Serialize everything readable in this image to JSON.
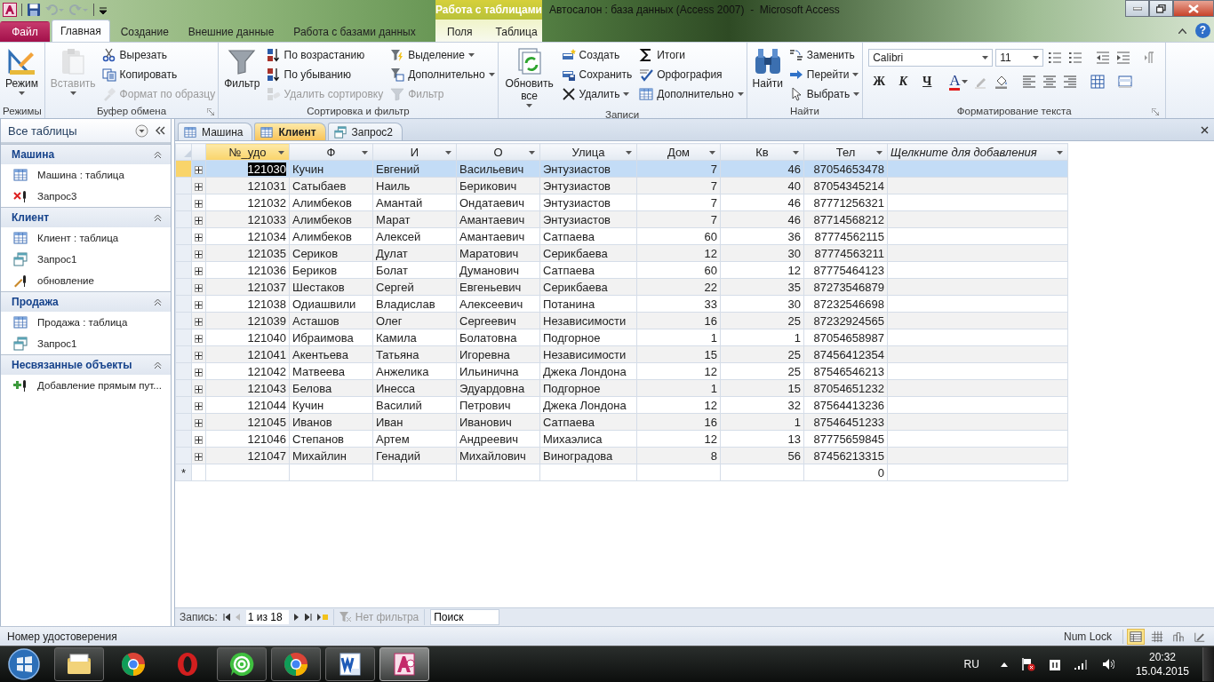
{
  "title_bar": {
    "context_group": "Работа с таблицами",
    "title": "Автосалон : база данных (Access 2007)  -  Microsoft Access",
    "help": "?"
  },
  "ribbon_tabs": [
    {
      "label": "Файл",
      "kind": "file",
      "selected": false
    },
    {
      "label": "Главная",
      "kind": "normal",
      "selected": true
    },
    {
      "label": "Создание",
      "kind": "normal",
      "selected": false
    },
    {
      "label": "Внешние данные",
      "kind": "normal",
      "selected": false
    },
    {
      "label": "Работа с базами данных",
      "kind": "normal",
      "selected": false
    },
    {
      "label": "Поля",
      "kind": "context",
      "selected": false
    },
    {
      "label": "Таблица",
      "kind": "context",
      "selected": false
    }
  ],
  "ribbon_groups": [
    {
      "label": "Режимы",
      "launcher": false,
      "items": [
        {
          "label": "Режим",
          "kind": "large",
          "dropdown": true,
          "disabled": false
        }
      ]
    },
    {
      "label": "Буфер обмена",
      "launcher": true,
      "items": [
        {
          "label": "Вставить",
          "kind": "large",
          "dropdown": true,
          "disabled": true
        },
        {
          "label": "Вырезать",
          "kind": "small",
          "dropdown": false,
          "disabled": false
        },
        {
          "label": "Копировать",
          "kind": "small",
          "dropdown": false,
          "disabled": false
        },
        {
          "label": "Формат по образцу",
          "kind": "small",
          "dropdown": false,
          "disabled": true
        }
      ]
    },
    {
      "label": "Сортировка и фильтр",
      "launcher": false,
      "items": [
        {
          "label": "Фильтр",
          "kind": "large",
          "dropdown": false,
          "disabled": false
        },
        {
          "label": "По возрастанию",
          "kind": "small",
          "dropdown": false,
          "disabled": false
        },
        {
          "label": "По убыванию",
          "kind": "small",
          "dropdown": false,
          "disabled": false
        },
        {
          "label": "Удалить сортировку",
          "kind": "small",
          "dropdown": false,
          "disabled": true
        },
        {
          "label": "Выделение",
          "kind": "small",
          "dropdown": true,
          "disabled": false
        },
        {
          "label": "Дополнительно",
          "kind": "small",
          "dropdown": true,
          "disabled": false
        },
        {
          "label": "Фильтр",
          "kind": "small",
          "dropdown": false,
          "disabled": true
        }
      ]
    },
    {
      "label": "Записи",
      "launcher": false,
      "items": [
        {
          "label": "Обновить все",
          "kind": "large",
          "dropdown": true,
          "disabled": false
        },
        {
          "label": "Создать",
          "kind": "small",
          "dropdown": false,
          "disabled": false
        },
        {
          "label": "Сохранить",
          "kind": "small",
          "dropdown": false,
          "disabled": false
        },
        {
          "label": "Удалить",
          "kind": "small",
          "dropdown": true,
          "disabled": false
        },
        {
          "label": "Итоги",
          "kind": "small",
          "dropdown": false,
          "disabled": false
        },
        {
          "label": "Орфография",
          "kind": "small",
          "dropdown": false,
          "disabled": false
        },
        {
          "label": "Дополнительно",
          "kind": "small",
          "dropdown": true,
          "disabled": false
        }
      ]
    },
    {
      "label": "Найти",
      "launcher": false,
      "items": [
        {
          "label": "Найти",
          "kind": "large",
          "dropdown": false,
          "disabled": false
        },
        {
          "label": "Заменить",
          "kind": "small",
          "dropdown": false,
          "disabled": false
        },
        {
          "label": "Перейти",
          "kind": "small",
          "dropdown": true,
          "disabled": false
        },
        {
          "label": "Выбрать",
          "kind": "small",
          "dropdown": true,
          "disabled": false
        }
      ]
    }
  ],
  "text_format_group": {
    "label": "Форматирование текста",
    "launcher": true,
    "font": "Calibri",
    "size": "11",
    "style_buttons": [
      "Ж",
      "К",
      "Ч"
    ],
    "font_color": "A"
  },
  "nav_pane": {
    "title": "Все таблицы",
    "groups": [
      {
        "title": "Машина",
        "items": [
          {
            "label": "Машина : таблица",
            "kind": "table"
          },
          {
            "label": "Запрос3",
            "kind": "delete_query"
          }
        ]
      },
      {
        "title": "Клиент",
        "items": [
          {
            "label": "Клиент : таблица",
            "kind": "table"
          },
          {
            "label": "Запрос1",
            "kind": "select_query"
          },
          {
            "label": "обновление",
            "kind": "update_query"
          }
        ]
      },
      {
        "title": "Продажа",
        "items": [
          {
            "label": "Продажа : таблица",
            "kind": "table"
          },
          {
            "label": "Запрос1",
            "kind": "select_query"
          }
        ]
      },
      {
        "title": "Несвязанные объекты",
        "items": [
          {
            "label": "Добавление прямым пут...",
            "kind": "append_query"
          }
        ]
      }
    ]
  },
  "document_tabs": [
    {
      "label": "Машина",
      "kind": "table",
      "selected": false
    },
    {
      "label": "Клиент",
      "kind": "table",
      "selected": true
    },
    {
      "label": "Запрос2",
      "kind": "query",
      "selected": false
    }
  ],
  "table": {
    "columns": [
      {
        "label": "№_удо",
        "kind": "number",
        "selected": true
      },
      {
        "label": "Ф",
        "kind": "text",
        "selected": false
      },
      {
        "label": "И",
        "kind": "text",
        "selected": false
      },
      {
        "label": "О",
        "kind": "text",
        "selected": false
      },
      {
        "label": "Улица",
        "kind": "text",
        "selected": false
      },
      {
        "label": "Дом",
        "kind": "number",
        "selected": false
      },
      {
        "label": "Кв",
        "kind": "number",
        "selected": false
      },
      {
        "label": "Тел",
        "kind": "number",
        "selected": false
      },
      {
        "label": "Щелкните для добавления",
        "kind": "add",
        "selected": false
      }
    ],
    "rows": [
      {
        "selected": true,
        "cells": [
          "121030",
          "Кучин",
          "Евгений",
          "Васильевич",
          "Энтузиастов",
          "7",
          "46",
          "87054653478"
        ]
      },
      {
        "selected": false,
        "cells": [
          "121031",
          "Сатыбаев",
          "Наиль",
          "Берикович",
          "Энтузиастов",
          "7",
          "40",
          "87054345214"
        ]
      },
      {
        "selected": false,
        "cells": [
          "121032",
          "Алимбеков",
          "Амантай",
          "Ондатаевич",
          "Энтузиастов",
          "7",
          "46",
          "87771256321"
        ]
      },
      {
        "selected": false,
        "cells": [
          "121033",
          "Алимбеков",
          "Марат",
          "Амантаевич",
          "Энтузиастов",
          "7",
          "46",
          "87714568212"
        ]
      },
      {
        "selected": false,
        "cells": [
          "121034",
          "Алимбеков",
          "Алексей",
          "Амантаевич",
          "Сатпаева",
          "60",
          "36",
          "87774562115"
        ]
      },
      {
        "selected": false,
        "cells": [
          "121035",
          "Сериков",
          "Дулат",
          "Маратович",
          "Серикбаева",
          "12",
          "30",
          "87774563211"
        ]
      },
      {
        "selected": false,
        "cells": [
          "121036",
          "Бериков",
          "Болат",
          "Думанович",
          "Сатпаева",
          "60",
          "12",
          "87775464123"
        ]
      },
      {
        "selected": false,
        "cells": [
          "121037",
          "Шестаков",
          "Сергей",
          "Евгеньевич",
          "Серикбаева",
          "22",
          "35",
          "87273546879"
        ]
      },
      {
        "selected": false,
        "cells": [
          "121038",
          "Одиашвили",
          "Владислав",
          "Алексеевич",
          "Потанина",
          "33",
          "30",
          "87232546698"
        ]
      },
      {
        "selected": false,
        "cells": [
          "121039",
          "Асташов",
          "Олег",
          "Сергеевич",
          "Независимости",
          "16",
          "25",
          "87232924565"
        ]
      },
      {
        "selected": false,
        "cells": [
          "121040",
          "Ибраимова",
          "Камила",
          "Болатовна",
          "Подгорное",
          "1",
          "1",
          "87054658987"
        ]
      },
      {
        "selected": false,
        "cells": [
          "121041",
          "Акентьева",
          "Татьяна",
          "Игоревна",
          "Независимости",
          "15",
          "25",
          "87456412354"
        ]
      },
      {
        "selected": false,
        "cells": [
          "121042",
          "Матвеева",
          "Анжелика",
          "Ильинична",
          "Джека Лондона",
          "12",
          "25",
          "87546546213"
        ]
      },
      {
        "selected": false,
        "cells": [
          "121043",
          "Белова",
          "Инесса",
          "Эдуардовна",
          "Подгорное",
          "1",
          "15",
          "87054651232"
        ]
      },
      {
        "selected": false,
        "cells": [
          "121044",
          "Кучин",
          "Василий",
          "Петрович",
          "Джека Лондона",
          "12",
          "32",
          "87564413236"
        ]
      },
      {
        "selected": false,
        "cells": [
          "121045",
          "Иванов",
          "Иван",
          "Иванович",
          "Сатпаева",
          "16",
          "1",
          "87546451233"
        ]
      },
      {
        "selected": false,
        "cells": [
          "121046",
          "Степанов",
          "Артем",
          "Андреевич",
          "Михаэлиса",
          "12",
          "13",
          "87775659845"
        ]
      },
      {
        "selected": false,
        "cells": [
          "121047",
          "Михайлин",
          "Генадий",
          "Михайлович",
          "Виноградова",
          "8",
          "56",
          "87456213315"
        ]
      }
    ],
    "new_row": {
      "marker": "*",
      "last_value": "0"
    }
  },
  "record_nav": {
    "label": "Запись:",
    "position": "1 из 18",
    "filter": "Нет фильтра",
    "search_placeholder": "Поиск"
  },
  "status_bar": {
    "text": "Номер удостоверения",
    "num_lock": "Num Lock",
    "views": [
      {
        "kind": "datasheet",
        "selected": true
      },
      {
        "kind": "pivot_table",
        "selected": false
      },
      {
        "kind": "pivot_chart",
        "selected": false
      },
      {
        "kind": "design",
        "selected": false
      }
    ]
  },
  "taskbar": {
    "apps": [
      {
        "kind": "explorer",
        "running": true,
        "selected": false
      },
      {
        "kind": "chrome",
        "running": false,
        "selected": false
      },
      {
        "kind": "opera",
        "running": false,
        "selected": false
      },
      {
        "kind": "mail_agent",
        "running": true,
        "selected": false
      },
      {
        "kind": "chrome",
        "running": true,
        "selected": false
      },
      {
        "kind": "word",
        "running": true,
        "selected": false
      },
      {
        "kind": "access",
        "running": true,
        "selected": true
      }
    ],
    "language": "RU",
    "time": "20:32",
    "date": "15.04.2015"
  }
}
